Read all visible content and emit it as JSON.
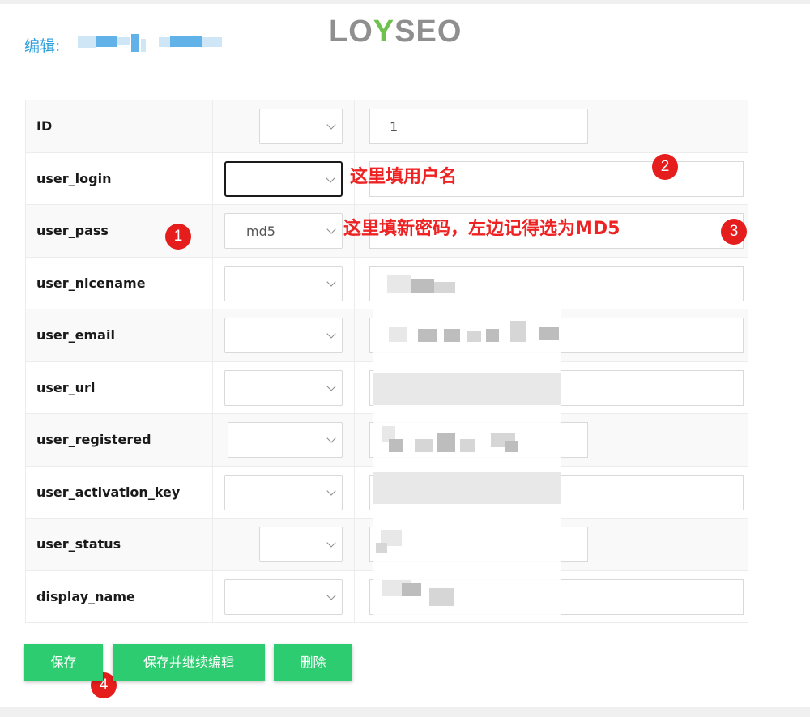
{
  "header": {
    "title_prefix": "编辑:",
    "logo_parts": [
      "LO",
      "Y",
      "SEO"
    ]
  },
  "form": {
    "rows": [
      {
        "label": "ID",
        "select_value": "",
        "input_value": "1"
      },
      {
        "label": "user_login",
        "select_value": "",
        "input_value": ""
      },
      {
        "label": "user_pass",
        "select_value": "md5",
        "input_value": ""
      },
      {
        "label": "user_nicename",
        "select_value": "",
        "input_value": ""
      },
      {
        "label": "user_email",
        "select_value": "",
        "input_value": ""
      },
      {
        "label": "user_url",
        "select_value": "",
        "input_value": ""
      },
      {
        "label": "user_registered",
        "select_value": "",
        "input_value": ""
      },
      {
        "label": "user_activation_key",
        "select_value": "",
        "input_value": ""
      },
      {
        "label": "user_status",
        "select_value": "",
        "input_value": ""
      },
      {
        "label": "display_name",
        "select_value": "",
        "input_value": ""
      }
    ]
  },
  "annotations": {
    "note_username": "这里填用户名",
    "note_password": "这里填新密码，左边记得选为MD5",
    "badges": [
      "1",
      "2",
      "3",
      "4"
    ]
  },
  "buttons": {
    "save": "保存",
    "save_continue": "保存并继续编辑",
    "delete": "删除"
  },
  "colors": {
    "title": "#2e9fdc",
    "button": "#2ecc71",
    "annotation": "#ee2222",
    "badge": "#e51d1d"
  }
}
